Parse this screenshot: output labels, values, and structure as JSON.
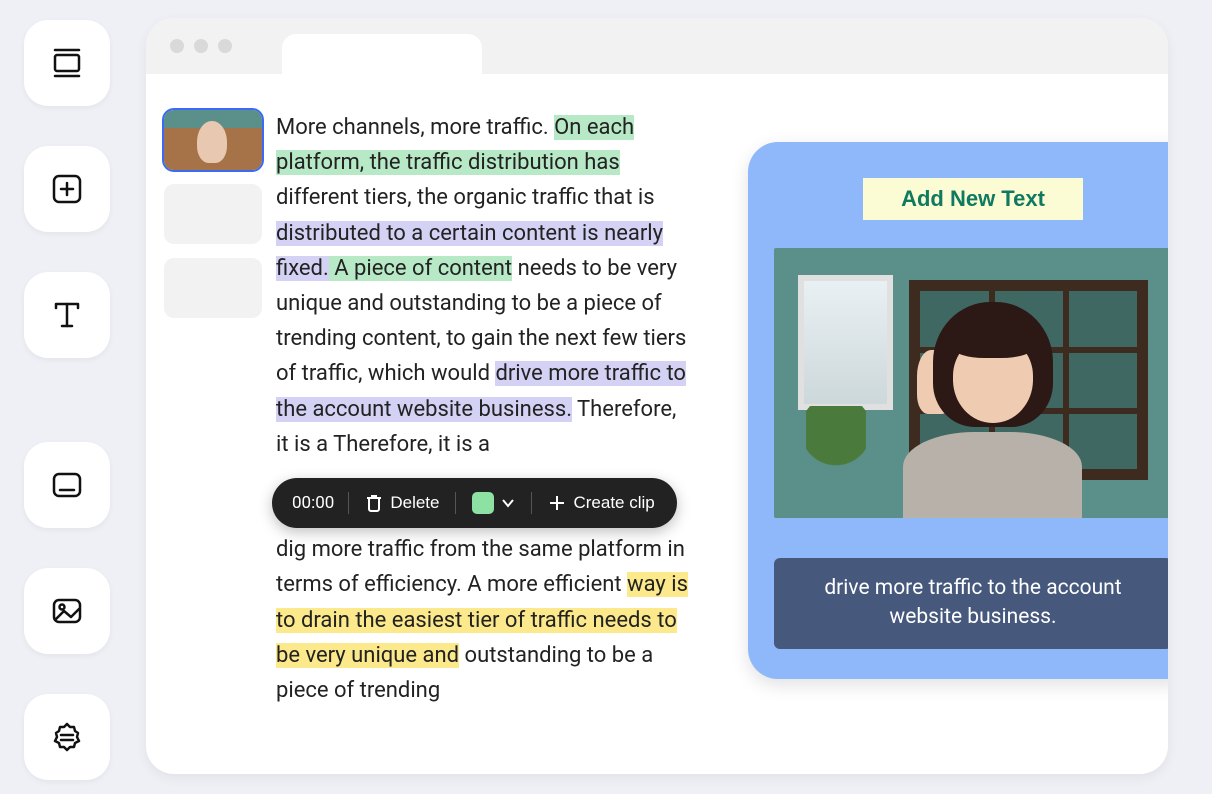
{
  "toolbar": {
    "timestamp": "00:00",
    "delete_label": "Delete",
    "create_clip_label": "Create clip",
    "swatch_color": "#8de2a3"
  },
  "preview": {
    "add_text_label": "Add New Text",
    "caption": "drive more traffic to the account website business."
  },
  "highlight_colors": {
    "green": "#b8e9c7",
    "purple": "#d4d2f4",
    "yellow": "#fbe98c"
  },
  "transcript": {
    "segments": [
      {
        "text": "More channels, more traffic. ",
        "hl": null
      },
      {
        "text": "On each platform, the traffic distribution has",
        "hl": "green"
      },
      {
        "text": " different tiers, the organic traffic that is ",
        "hl": null
      },
      {
        "text": "distributed to a certain content is nearly fixed.",
        "hl": "purple"
      },
      {
        "text": " A piece of content",
        "hl": "green"
      },
      {
        "text": " needs to be very unique and outstanding to be a piece of trending content, to gain the next few tiers of traffic, which would ",
        "hl": null
      },
      {
        "text": "drive more traffic to the account website business.",
        "hl": "purple"
      },
      {
        "text": " Therefore, it is a\n\n\ndig more traffic from the same platform in terms of efficiency. A more efficient ",
        "hl": null
      },
      {
        "text": "way is to drain the easiest tier of traffic needs to be very unique and",
        "hl": "yellow"
      },
      {
        "text": " outstanding to be a piece of trending",
        "hl": null
      }
    ]
  },
  "rail_icons": [
    "layout-icon",
    "add-icon",
    "text-icon",
    "caption-icon",
    "image-icon",
    "badge-icon"
  ]
}
